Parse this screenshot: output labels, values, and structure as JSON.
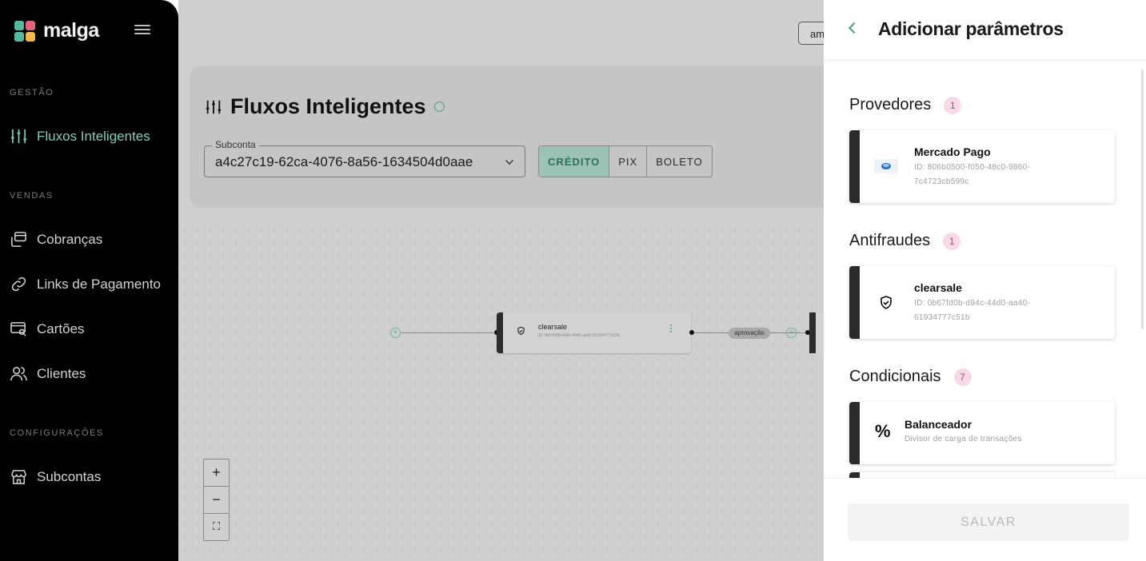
{
  "sidebar": {
    "logo_text": "malga",
    "sections": {
      "gestao": "GESTÃO",
      "vendas": "VENDAS",
      "configuracoes": "CONFIGURAÇÕES"
    },
    "items": [
      {
        "label": "Fluxos Inteligentes",
        "icon": "sliders-icon",
        "active": true
      },
      {
        "label": "Cobranças",
        "icon": "charges-icon"
      },
      {
        "label": "Links de Pagamento",
        "icon": "link-icon"
      },
      {
        "label": "Cartões",
        "icon": "card-search-icon"
      },
      {
        "label": "Clientes",
        "icon": "users-icon"
      },
      {
        "label": "Subcontas",
        "icon": "store-icon"
      }
    ]
  },
  "main": {
    "top_chip": "am",
    "title": "Fluxos Inteligentes",
    "subconta": {
      "label": "Subconta",
      "value": "a4c27c19-62ca-4076-8a56-1634504d0aae"
    },
    "payment_methods": [
      "CRÉDITO",
      "PIX",
      "BOLETO"
    ],
    "selected_method": "CRÉDITO",
    "flow": {
      "node_name": "clearsale",
      "node_id": "ID: 0b67fd0b-d94c-44d0-aa40-61934777c51b",
      "edge_label": "aprovação"
    },
    "zoom": {
      "in": "+",
      "out": "−",
      "fit": "⛶"
    }
  },
  "panel": {
    "title": "Adicionar parâmetros",
    "sections": [
      {
        "title": "Provedores",
        "count": "1",
        "items": [
          {
            "name": "Mercado Pago",
            "sub": "ID: 806b0500-f050-48c0-9860-7c4723cb599c",
            "icon": "mercado-pago-icon"
          }
        ]
      },
      {
        "title": "Antifraudes",
        "count": "1",
        "items": [
          {
            "name": "clearsale",
            "sub": "ID: 0b67fd0b-d94c-44d0-aa40-61934777c51b",
            "icon": "shield-icon"
          }
        ]
      },
      {
        "title": "Condicionais",
        "count": "7",
        "items": [
          {
            "name": "Balanceador",
            "sub": "Divisor de carga de transações",
            "icon": "percent-icon"
          }
        ]
      }
    ],
    "save_label": "SALVAR"
  },
  "colors": {
    "accent": "#4e9e88",
    "sidebar_bg": "#000000",
    "badge_bg": "#f8d9e7"
  }
}
